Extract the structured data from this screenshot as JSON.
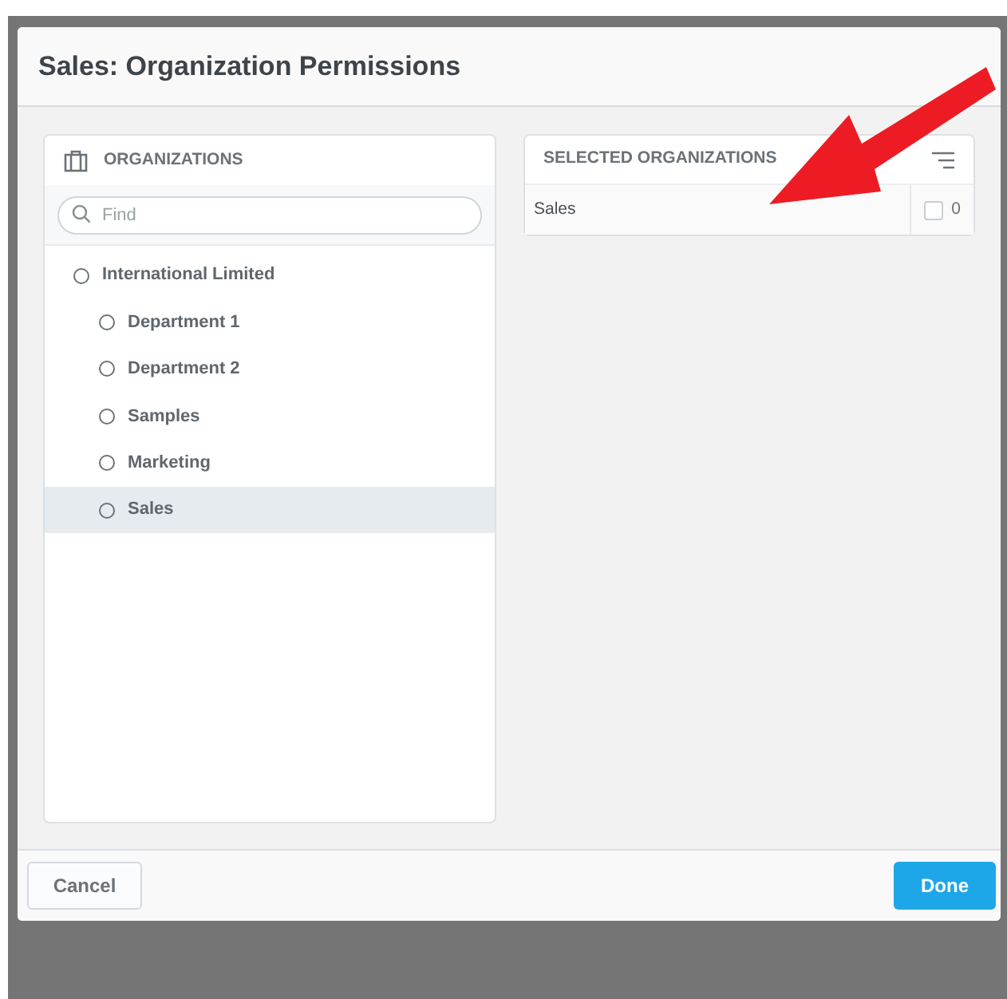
{
  "dialog": {
    "title": "Sales: Organization Permissions"
  },
  "organizations": {
    "heading": "ORGANIZATIONS",
    "search": {
      "placeholder": "Find"
    },
    "tree": [
      {
        "label": "International Limited",
        "selected": false,
        "children": [
          {
            "label": "Department 1",
            "selected": false
          },
          {
            "label": "Department 2",
            "selected": false
          },
          {
            "label": "Samples",
            "selected": false
          },
          {
            "label": "Marketing",
            "selected": false
          },
          {
            "label": "Sales",
            "selected": true
          }
        ]
      }
    ]
  },
  "selected_organizations": {
    "heading": "SELECTED ORGANIZATIONS",
    "rows": [
      {
        "name": "Sales",
        "checked": false,
        "count": "0"
      }
    ]
  },
  "buttons": {
    "cancel": "Cancel",
    "done": "Done"
  }
}
